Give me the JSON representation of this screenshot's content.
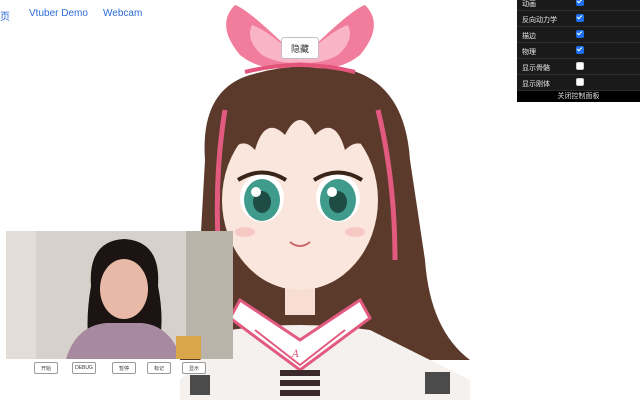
{
  "nav": {
    "home_label": "页",
    "vtuber_label": "Vtuber Demo",
    "webcam_label": "Webcam"
  },
  "avatar": {
    "hide_button_label": "隐藏",
    "hair_color": "#5a3a2a",
    "bow_color": "#f07b9a",
    "eye_color": "#3f9b8c"
  },
  "control_panel": {
    "rows": [
      {
        "label": "动画",
        "checked": true
      },
      {
        "label": "反向动力学",
        "checked": true
      },
      {
        "label": "描边",
        "checked": true
      },
      {
        "label": "物理",
        "checked": true
      },
      {
        "label": "显示骨骼",
        "checked": false
      },
      {
        "label": "显示刚体",
        "checked": false
      }
    ],
    "close_label": "关闭控制面板"
  },
  "webcam": {
    "buttons": [
      "开始",
      "DEBUG",
      "暂停",
      "标记",
      "显示"
    ]
  },
  "colors": {
    "link": "#2b6cd8",
    "panel_bg": "#1a1a1a",
    "checkbox_on": "#1e6ff0"
  }
}
